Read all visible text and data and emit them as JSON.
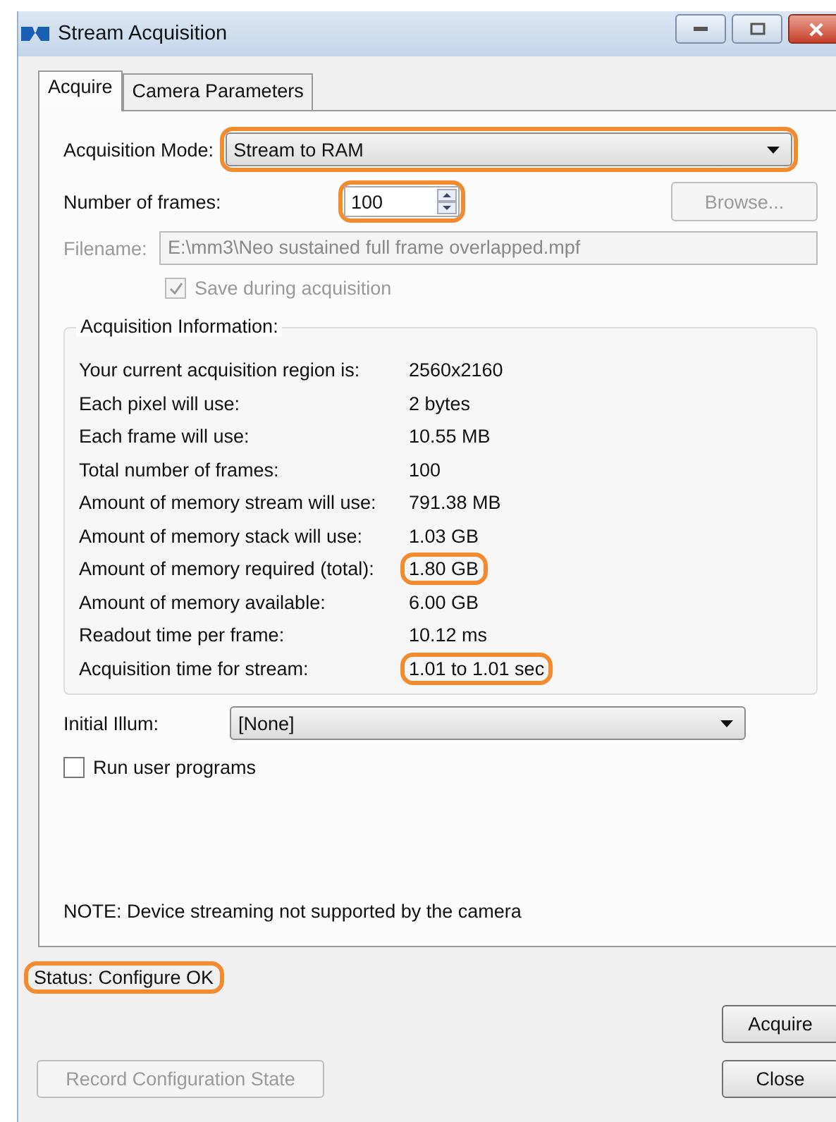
{
  "window": {
    "title": "Stream Acquisition"
  },
  "tabs": [
    {
      "label": "Acquire",
      "selected": true
    },
    {
      "label": "Camera Parameters",
      "selected": false
    }
  ],
  "acquisition_mode": {
    "label": "Acquisition Mode:",
    "value": "Stream to RAM",
    "highlighted": true
  },
  "frames": {
    "label": "Number of frames:",
    "value": "100",
    "highlighted": true
  },
  "browse_button": {
    "label": "Browse...",
    "disabled": true
  },
  "filename": {
    "label": "Filename:",
    "value": "E:\\mm3\\Neo sustained full frame overlapped.mpf",
    "disabled": true
  },
  "save_during": {
    "label": "Save during acquisition",
    "checked": true,
    "disabled": true
  },
  "acquisition_info": {
    "title": "Acquisition Information:",
    "rows": [
      {
        "label": "Your current acquisition region is:",
        "value": "2560x2160",
        "highlighted": false
      },
      {
        "label": "Each pixel will use:",
        "value": "2 bytes",
        "highlighted": false
      },
      {
        "label": "Each frame will use:",
        "value": "10.55 MB",
        "highlighted": false
      },
      {
        "label": "Total number of frames:",
        "value": "100",
        "highlighted": false
      },
      {
        "label": "Amount of memory stream will use:",
        "value": "791.38 MB",
        "highlighted": false
      },
      {
        "label": "Amount of memory stack will use:",
        "value": "1.03 GB",
        "highlighted": false
      },
      {
        "label": "Amount of memory required (total):",
        "value": "1.80 GB",
        "highlighted": true
      },
      {
        "label": "Amount of memory available:",
        "value": "6.00 GB",
        "highlighted": false
      },
      {
        "label": "Readout time per frame:",
        "value": "10.12 ms",
        "highlighted": false
      },
      {
        "label": "Acquisition time for stream:",
        "value": "1.01 to 1.01 sec",
        "highlighted": true
      }
    ]
  },
  "initial_illum": {
    "label": "Initial Illum:",
    "value": "[None]"
  },
  "run_user_programs": {
    "label": "Run user programs",
    "checked": false
  },
  "note": "NOTE: Device streaming not supported by the camera",
  "status": {
    "text": "Status:  Configure OK",
    "highlighted": true
  },
  "buttons": [
    {
      "label": "Acquire",
      "disabled": false
    },
    {
      "label": "Close",
      "disabled": false
    }
  ],
  "record_button": {
    "label": "Record Configuration State",
    "disabled": true
  }
}
